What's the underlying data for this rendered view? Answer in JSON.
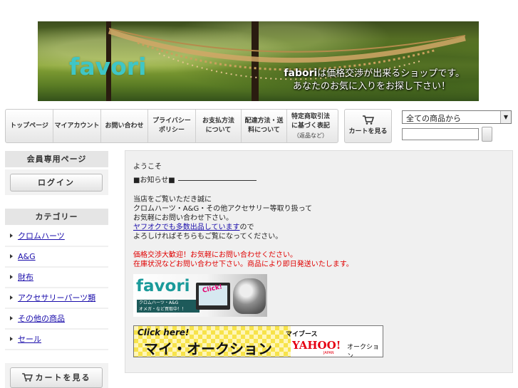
{
  "banner": {
    "logo": "favori",
    "tagline_brand": "fabori",
    "tagline_line1": "は価格交渉が出来るショップです。",
    "tagline_line2": "あなたのお気に入りをお探し下さい！"
  },
  "nav": {
    "items": [
      {
        "label": "トップページ"
      },
      {
        "label": "マイアカウント"
      },
      {
        "label": "お問い合わせ"
      },
      {
        "label": "プライバシーポリシー"
      },
      {
        "label": "お支払方法について"
      },
      {
        "label": "配達方法・送料について"
      },
      {
        "label": "特定商取引法に基づく表記",
        "sub": "（返品など）"
      }
    ],
    "cart_label": "カートを見る"
  },
  "search": {
    "category_selected": "全ての商品から",
    "input_value": ""
  },
  "sidebar": {
    "member_heading": "会員専用ページ",
    "login_label": "ログイン",
    "category_heading": "カテゴリー",
    "categories": [
      {
        "label": "クロムハーツ"
      },
      {
        "label": "A&G"
      },
      {
        "label": "財布"
      },
      {
        "label": "アクセサリーパーツ類"
      },
      {
        "label": "その他の商品"
      },
      {
        "label": "セール"
      }
    ],
    "cart_label": "カートを見る"
  },
  "main": {
    "line1": "ようこそ",
    "heading": "■お知らせ■",
    "para1": "当店をご覧いただき誠に",
    "para2": "クロムハーツ・A&G・その他アクセサリー等取り扱って",
    "para3": "お気軽にお問い合わせ下さい。",
    "link_text": "ヤフオクでも多数出品しています",
    "link_suffix": "ので",
    "para4": "よろしければそちらもご覧になってください。",
    "red1": "価格交渉大歓迎！お気軽にお問い合わせください。",
    "red2": "在庫状況などお問い合わせ下さい。商品により即日発送いたします。",
    "promo": {
      "logo": "favori",
      "click": "Click!",
      "sub1": "クロムハーツ・A&G",
      "sub2": "オメガ・など買取中！！"
    },
    "auction": {
      "click_here": "Click here!",
      "title": "マイ・オークション",
      "mybooth": "マイブース",
      "yahoo": "YAHOO!",
      "japan": "JAPAN",
      "yauc": "オークション"
    }
  },
  "colors": {
    "logo_teal": "#3fc6c6",
    "link_blue": "#1a0dab",
    "notice_red": "#e00000",
    "auction_yellow": "#f7e34a"
  }
}
